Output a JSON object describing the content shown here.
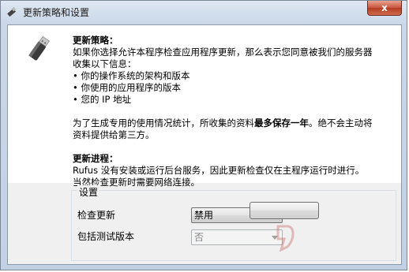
{
  "window": {
    "title": "更新策略和设置",
    "close_label": "x"
  },
  "policy": {
    "heading": "更新策略：",
    "intro_1": "如果你选择允许本程序检查应用程序更新，那么表示您同意被我们的服务器",
    "intro_2": "收集以下信息：",
    "bullets": [
      "你的操作系统的架构和版本",
      "你使用的应用程序的版本",
      "您的 IP 地址"
    ],
    "stats_1_pre": "为了生成专用的使用情况统计，所收集的资料",
    "stats_1_bold": "最多保存一年",
    "stats_1_post": "。绝不会主动将",
    "stats_2": "资料提供给第三方。",
    "process_heading": "更新进程：",
    "process_1": "Rufus 没有安装或运行后台服务，因此更新检查仅在主程序运行时进行。",
    "process_2": "当然检查更新时需要网络连接。"
  },
  "settings": {
    "group_label": "设置",
    "check_updates_label": "检查更新",
    "check_updates_value": "禁用",
    "include_beta_label": "包括测试版本",
    "include_beta_value": "否"
  },
  "icons": {
    "title": "usb-drive-icon",
    "main": "usb-drive-icon"
  }
}
